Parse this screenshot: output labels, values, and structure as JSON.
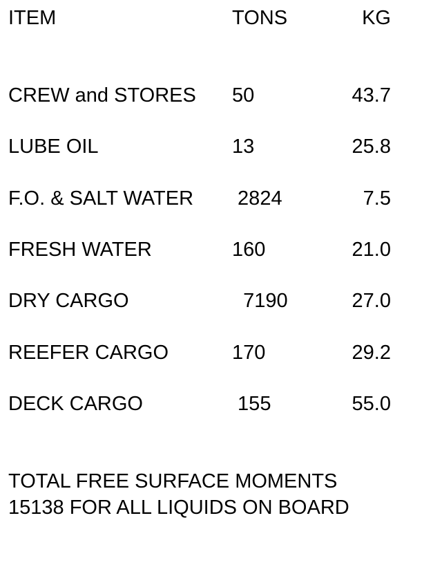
{
  "header": {
    "item": "ITEM",
    "tons": "TONS",
    "kg": "KG"
  },
  "rows": [
    {
      "item": "CREW and STORES",
      "tons": "50",
      "kg": "43.7"
    },
    {
      "item": "LUBE OIL",
      "tons": "13",
      "kg": "25.8"
    },
    {
      "item": "F.O. & SALT WATER",
      "tons": " 2824",
      "kg": "7.5"
    },
    {
      "item": "FRESH WATER",
      "tons": "160",
      "kg": "21.0"
    },
    {
      "item": "DRY CARGO",
      "tons": "  7190",
      "kg": "27.0"
    },
    {
      "item": "REEFER CARGO",
      "tons": "170",
      "kg": "29.2"
    },
    {
      "item": "DECK CARGO",
      "tons": " 155",
      "kg": "55.0"
    }
  ],
  "footer": {
    "line1": "TOTAL FREE SURFACE MOMENTS",
    "line2": "15138 FOR ALL LIQUIDS ON BOARD"
  }
}
